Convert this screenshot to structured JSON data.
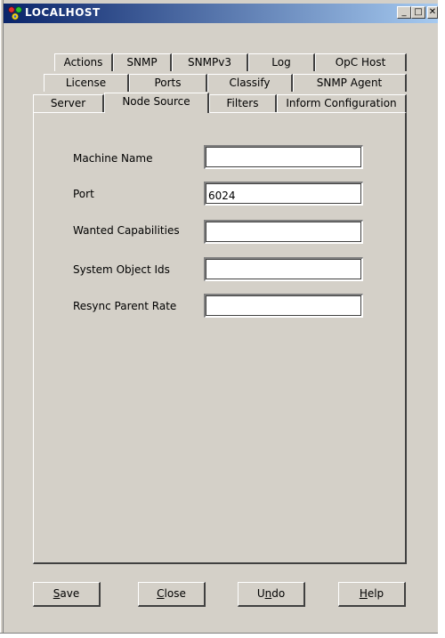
{
  "window": {
    "title": "LOCALHOST",
    "icon": "app-network-icon",
    "minimize_glyph": "_",
    "maximize_glyph": "□",
    "close_glyph": "✕"
  },
  "tabs": {
    "row1": [
      "Actions",
      "SNMP",
      "SNMPv3",
      "Log",
      "OpC Host"
    ],
    "row2": [
      "License",
      "Ports",
      "Classify",
      "SNMP Agent"
    ],
    "row3": [
      "Server",
      "Node Source",
      "Filters",
      "Inform Configuration"
    ],
    "active": "Node Source"
  },
  "form": {
    "machine_name": {
      "label": "Machine Name",
      "value": ""
    },
    "port": {
      "label": "Port",
      "value": "6024"
    },
    "wanted_capabilities": {
      "label": "Wanted Capabilities",
      "value": ""
    },
    "system_object_ids": {
      "label": "System Object Ids",
      "value": ""
    },
    "resync_parent_rate": {
      "label": "Resync Parent Rate",
      "value": ""
    }
  },
  "buttons": {
    "save": {
      "mnemonic": "S",
      "rest": "ave"
    },
    "close": {
      "mnemonic": "C",
      "rest": "lose"
    },
    "undo": {
      "pre": "U",
      "mnemonic": "n",
      "rest": "do"
    },
    "help": {
      "mnemonic": "H",
      "rest": "elp"
    }
  }
}
